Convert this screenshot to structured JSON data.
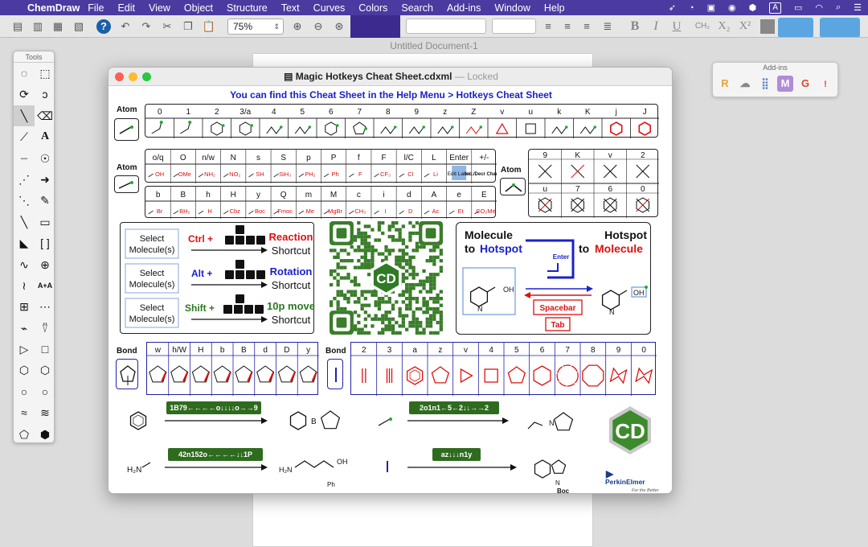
{
  "menubar": {
    "app_name": "ChemDraw",
    "items": [
      "File",
      "Edit",
      "View",
      "Object",
      "Structure",
      "Text",
      "Curves",
      "Colors",
      "Search",
      "Add-ins",
      "Window",
      "Help"
    ],
    "keyboard_indicator": "A"
  },
  "toolbar": {
    "zoom_value": "75%",
    "text_buttons": [
      "B",
      "I",
      "U",
      "CH₂",
      "X₂",
      "X²"
    ]
  },
  "document": {
    "title": "Untitled Document-1"
  },
  "tools_palette": {
    "title": "Tools",
    "tools": [
      "lasso",
      "marquee",
      "rotate",
      "pen-bond",
      "bond",
      "eraser",
      "wedge",
      "text",
      "dashed-bond",
      "chain",
      "hash-wedge",
      "arrow",
      "dative-bond",
      "pen",
      "line",
      "rectangle",
      "bold-bond",
      "bracket",
      "wavy-bond",
      "orbital",
      "chain-tool",
      "text-format",
      "table",
      "symbol",
      "query",
      "stamp",
      "play",
      "square",
      "hexagon",
      "hexagon-filled",
      "circle",
      "circle-2",
      "cyclopentane",
      "cyclohexane",
      "pentagon",
      "cyclohexane-chair"
    ]
  },
  "addins": {
    "title": "Add-ins",
    "icons": [
      "R",
      "",
      "",
      "M",
      "G",
      "!"
    ]
  },
  "cheatsheet": {
    "window_title": "Magic Hotkeys Cheat Sheet.cdxml",
    "lock_label": "Locked",
    "help_line": "You can find this Cheat Sheet in the Help Menu > Hotkeys Cheat Sheet",
    "atom_label": "Atom",
    "bond_label": "Bond",
    "atom_row1_keys": [
      "0",
      "1",
      "2",
      "3/a",
      "4",
      "5",
      "6",
      "7",
      "8",
      "9",
      "z",
      "Z",
      "v",
      "u",
      "k",
      "K",
      "j",
      "J"
    ],
    "atom_row2_keys": [
      "o/q",
      "O",
      "n/w",
      "N",
      "s",
      "S",
      "p",
      "P",
      "f",
      "F",
      "l/C",
      "L",
      "Enter",
      "+/-"
    ],
    "atom_row2_labels": [
      "OH",
      "OMe",
      "NH₂",
      "NO₂",
      "SH",
      "SiH₃",
      "PH₂",
      "Ph",
      "F",
      "CF₃",
      "Cl",
      "Li",
      "Edit Label",
      "Inc./Decr Charge"
    ],
    "atom_row3_keys": [
      "b",
      "B",
      "h",
      "H",
      "y",
      "Q",
      "m",
      "M",
      "c",
      "i",
      "d",
      "A",
      "e",
      "E"
    ],
    "atom_row3_labels": [
      "Br",
      "BH₂",
      "H",
      "Cbz",
      "Boc",
      "Fmoc",
      "Me",
      "MgBr",
      "CH₃",
      "I",
      "D",
      "Ac",
      "Et",
      "CO₂Me"
    ],
    "atom_ring_keys": [
      "9",
      "K",
      "v",
      "2",
      "u",
      "7",
      "6",
      "0"
    ],
    "select_lines": [
      {
        "select": "Select Molecule(s)",
        "modifier": "Ctrl",
        "action": "Reaction",
        "shortcut": "Shortcut"
      },
      {
        "select": "Select Molecule(s)",
        "modifier": "Alt",
        "action": "Rotation",
        "shortcut": "Shortcut"
      },
      {
        "select": "Select Molecule(s)",
        "modifier": "Shift",
        "action": "10p move",
        "shortcut": "Shortcut"
      }
    ],
    "qr_badge": "CD",
    "hotspot": {
      "left_title_1": "Molecule",
      "left_title_2": "to",
      "left_title_3": "Hotspot",
      "right_title_1": "Hotspot",
      "right_title_2": "to",
      "right_title_3": "Molecule",
      "enter_key": "Enter",
      "spacebar": "Spacebar",
      "tab": "Tab",
      "oh_label": "OH"
    },
    "bond_keys_left": [
      "w",
      "h/W",
      "H",
      "b",
      "B",
      "d",
      "D",
      "y"
    ],
    "bond_keys_right": [
      "2",
      "3",
      "a",
      "z",
      "v",
      "4",
      "5",
      "6",
      "7",
      "8",
      "9",
      "0"
    ],
    "reactions": [
      {
        "code": "1B79←←←←o↓↓↓↓o→→9"
      },
      {
        "code": "2o1n1←5←2↓↓→→2"
      },
      {
        "code": "42n152o←←←←↓↓1P"
      },
      {
        "code": "az↓↓↓n1y"
      }
    ],
    "reaction_labels": {
      "h2n": "H₂N",
      "nh2": "H₂N",
      "oh": "OH",
      "ph": "Ph",
      "boc": "Boc",
      "n": "N",
      "b": "B"
    },
    "logo_text": "CD",
    "brand": "PerkinElmer",
    "brand_tagline": "For the Better"
  }
}
